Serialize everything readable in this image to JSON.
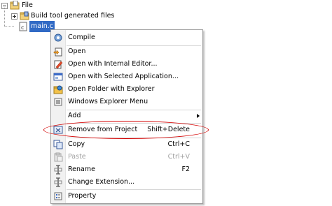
{
  "tree": {
    "root": {
      "label": "File",
      "icon": "folder-icon"
    },
    "child1": {
      "label": "Build tool generated files",
      "icon": "folder-icon"
    },
    "child2": {
      "label": "main.c",
      "icon": "c-file-icon"
    }
  },
  "context_menu": {
    "items": [
      {
        "label": "Compile",
        "icon": "compile-icon",
        "shortcut": ""
      },
      {
        "label": "Open",
        "icon": "open-icon",
        "shortcut": ""
      },
      {
        "label": "Open with Internal Editor...",
        "icon": "internal-editor-icon",
        "shortcut": ""
      },
      {
        "label": "Open with Selected Application...",
        "icon": "selected-application-icon",
        "shortcut": ""
      },
      {
        "label": "Open Folder with Explorer",
        "icon": "explorer-folder-icon",
        "shortcut": ""
      },
      {
        "label": "Windows Explorer Menu",
        "icon": "explorer-menu-icon",
        "shortcut": ""
      },
      {
        "label": "Add",
        "icon": "",
        "shortcut": ""
      },
      {
        "label": "Remove from Project",
        "icon": "remove-icon",
        "shortcut": "Shift+Delete"
      },
      {
        "label": "Copy",
        "icon": "copy-icon",
        "shortcut": "Ctrl+C"
      },
      {
        "label": "Paste",
        "icon": "paste-icon",
        "shortcut": "Ctrl+V"
      },
      {
        "label": "Rename",
        "icon": "rename-icon",
        "shortcut": "F2"
      },
      {
        "label": "Change Extension...",
        "icon": "change-extension-icon",
        "shortcut": ""
      },
      {
        "label": "Property",
        "icon": "property-icon",
        "shortcut": ""
      }
    ]
  },
  "colors": {
    "selection": "#316ac5",
    "highlight_ellipse": "#d40000",
    "disabled_text": "#a0a0a0"
  }
}
